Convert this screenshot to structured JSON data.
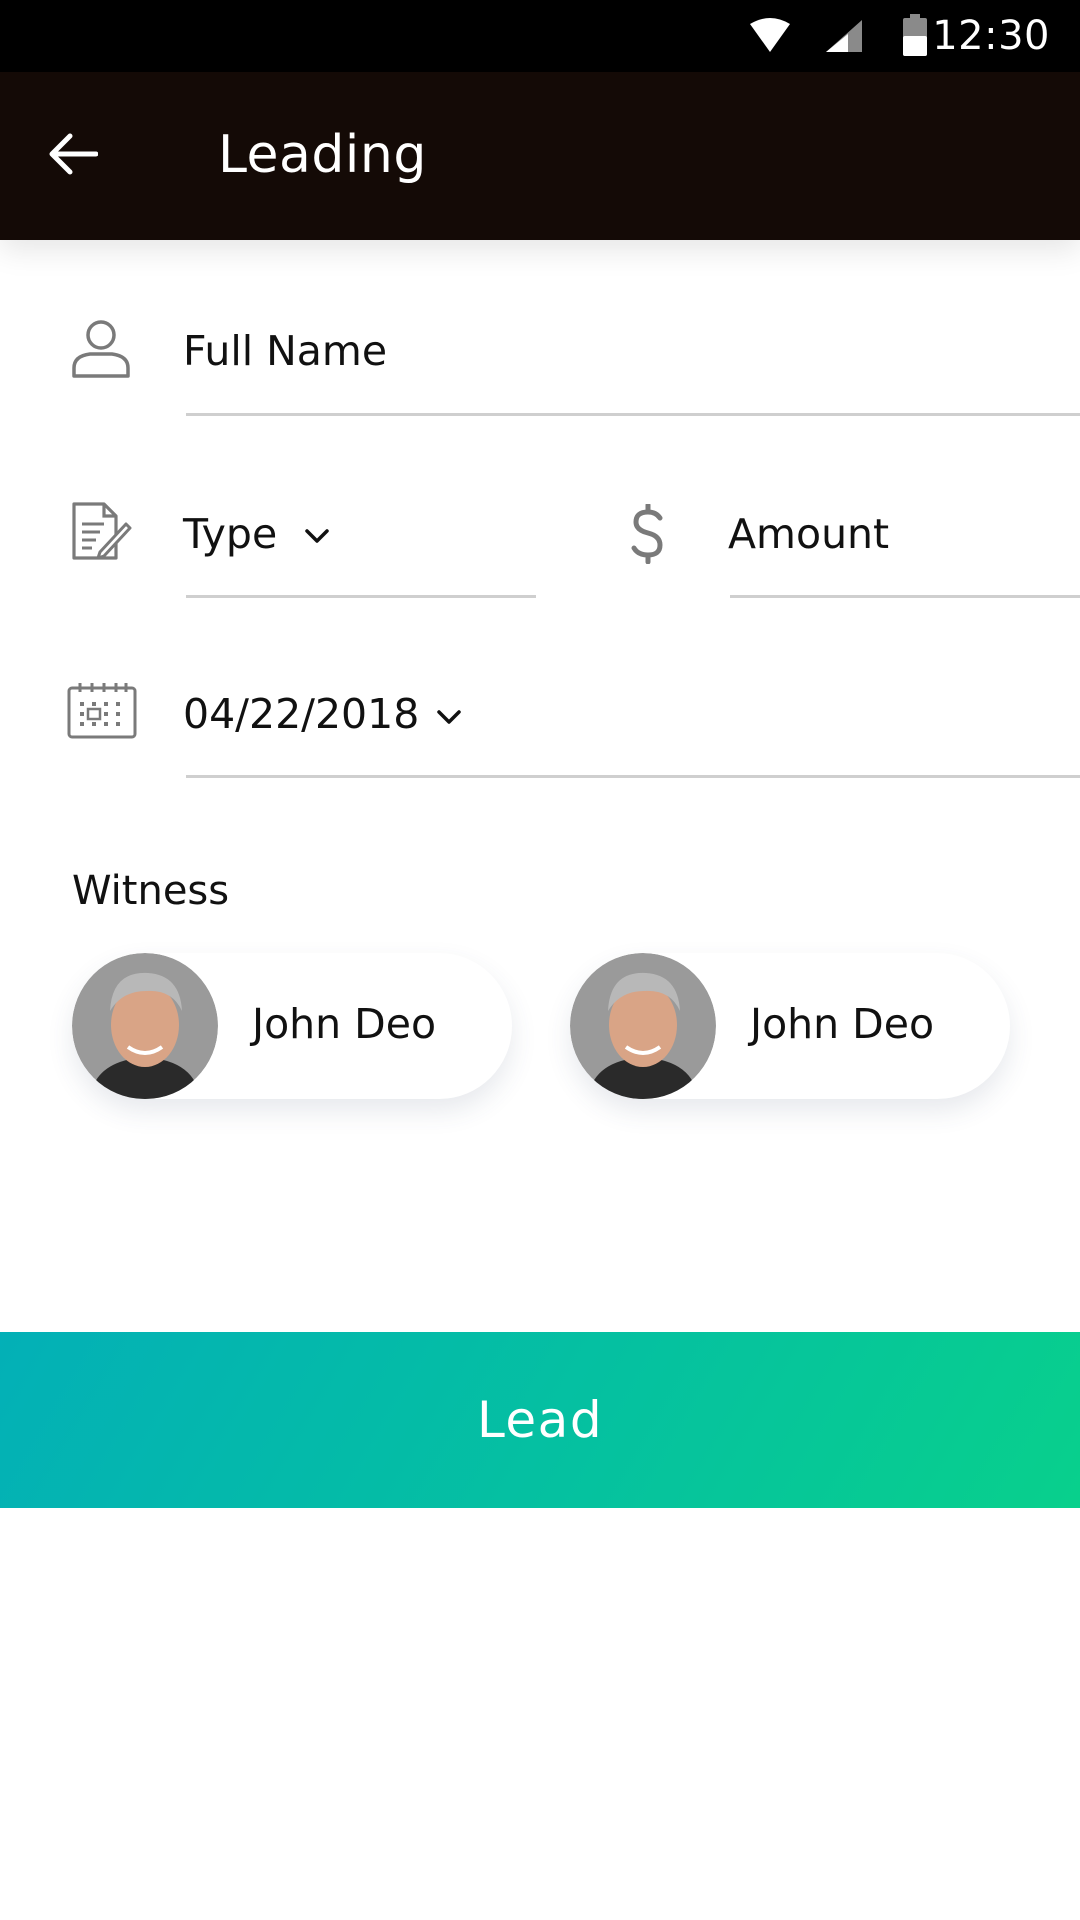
{
  "status_bar": {
    "time": "12:30",
    "icons": [
      "wifi-icon",
      "cell-signal-icon",
      "battery-icon"
    ]
  },
  "app_bar": {
    "back_icon": "arrow-left-icon",
    "title": "Leading"
  },
  "form": {
    "full_name": {
      "icon": "person-icon",
      "placeholder": "Full Name"
    },
    "type": {
      "icon": "document-edit-icon",
      "label": "Type"
    },
    "amount": {
      "icon": "dollar-icon",
      "label": "Amount"
    },
    "date": {
      "icon": "calendar-icon",
      "value": "04/22/2018"
    }
  },
  "witness": {
    "title": "Witness",
    "people": [
      {
        "name": "John Deo",
        "avatar": "avatar-photo"
      },
      {
        "name": "John Deo",
        "avatar": "avatar-photo"
      }
    ]
  },
  "actions": {
    "lead_label": "Lead"
  },
  "colors": {
    "app_bar": "#140a06",
    "button_gradient_start": "#03b0b7",
    "button_gradient_end": "#08d08c",
    "underline": "#cfcfcf",
    "icon_gray": "#7a7a7a"
  }
}
